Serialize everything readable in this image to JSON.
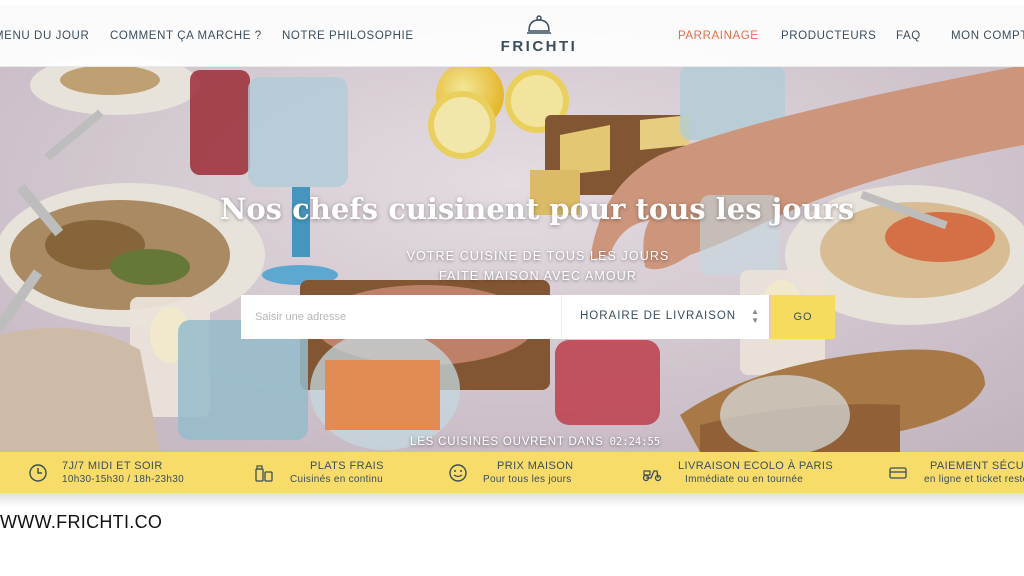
{
  "nav": {
    "left_links": [
      "MENU DU JOUR",
      "COMMENT ÇA MARCHE ?",
      "NOTRE PHILOSOPHIE"
    ],
    "brand": "FRICHTI",
    "right_links": [
      "PARRAINAGE",
      "PRODUCTEURS",
      "FAQ",
      "MON COMPTE"
    ],
    "accent_color": "#e86c47",
    "text_color": "#3a4e5c"
  },
  "hero": {
    "title": "Nos chefs cuisinent pour tous les jours",
    "subtitle_line1": "VOTRE CUISINE DE TOUS LES JOURS",
    "subtitle_line2": "FAITE MAISON AVEC AMOUR",
    "countdown_label": "LES CUISINES OUVRENT DANS",
    "countdown_value": "02:24:55"
  },
  "search": {
    "address_placeholder": "Saisir une adresse",
    "slot_label": "HORAIRE DE LIVRAISON",
    "go_label": "GO",
    "go_color": "#f6dc5c"
  },
  "features": [
    {
      "icon": "clock-icon",
      "title": "7J/7 MIDI ET SOIR",
      "subtitle": "10h30-15h30 / 18h-23h30"
    },
    {
      "icon": "jars-icon",
      "title": "PLATS FRAIS",
      "subtitle": "Cuisinés en continu"
    },
    {
      "icon": "smiley-icon",
      "title": "PRIX MAISON",
      "subtitle": "Pour tous les jours"
    },
    {
      "icon": "scooter-icon",
      "title": "LIVRAISON ECOLO À PARIS",
      "subtitle": "Immédiate ou en tournée"
    },
    {
      "icon": "card-icon",
      "title": "PAIEMENT SÉCURISÉ",
      "subtitle": "en ligne et ticket resto"
    }
  ],
  "features_bg": "#f7dc6a",
  "caption": "WWW.FRICHTI.CO"
}
